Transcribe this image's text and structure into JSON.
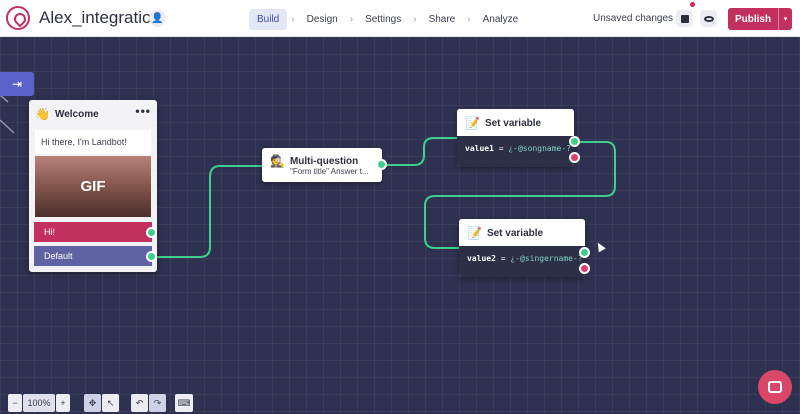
{
  "app": {
    "title": "Alex_integration"
  },
  "nav": {
    "tabs": [
      {
        "label": "Build",
        "active": true
      },
      {
        "label": "Design"
      },
      {
        "label": "Settings"
      },
      {
        "label": "Share"
      },
      {
        "label": "Analyze"
      }
    ],
    "separator": "›"
  },
  "status": {
    "unsaved": "Unsaved changes"
  },
  "publish": {
    "label": "Publish",
    "caret": "▾"
  },
  "icons": {
    "user": "user-icon",
    "save": "save-icon",
    "preview": "eye-icon",
    "collapse": "collapse-panel-icon",
    "chat": "chat-icon"
  },
  "colors": {
    "accent": "#c2305e",
    "canvas": "#2f3150",
    "wire": "#3ecf8e",
    "port_red": "#d93f6f"
  },
  "nodes": {
    "welcome": {
      "emoji": "👋",
      "title": "Welcome",
      "menu": "•••",
      "message": "Hi there, I'm Landbot!",
      "media_label": "GIF",
      "buttons": [
        "Hi!",
        "Default"
      ]
    },
    "multi_question": {
      "emoji": "🕵",
      "title": "Multi-question",
      "subtitle": "\"Form title\" Answer t..."
    },
    "set_variable_1": {
      "emoji": "📝",
      "title": "Set variable",
      "var_name": "value1",
      "op": " = ",
      "value": "¿-@songname-?"
    },
    "set_variable_2": {
      "emoji": "📝",
      "title": "Set variable",
      "var_name": "value2",
      "op": " = ",
      "value": "¿-@singername-?"
    }
  },
  "toolbar": {
    "zoom_out": "−",
    "zoom": "100%",
    "zoom_in": "+",
    "undo": "↶",
    "redo": "↷",
    "keyboard": "⌨"
  }
}
